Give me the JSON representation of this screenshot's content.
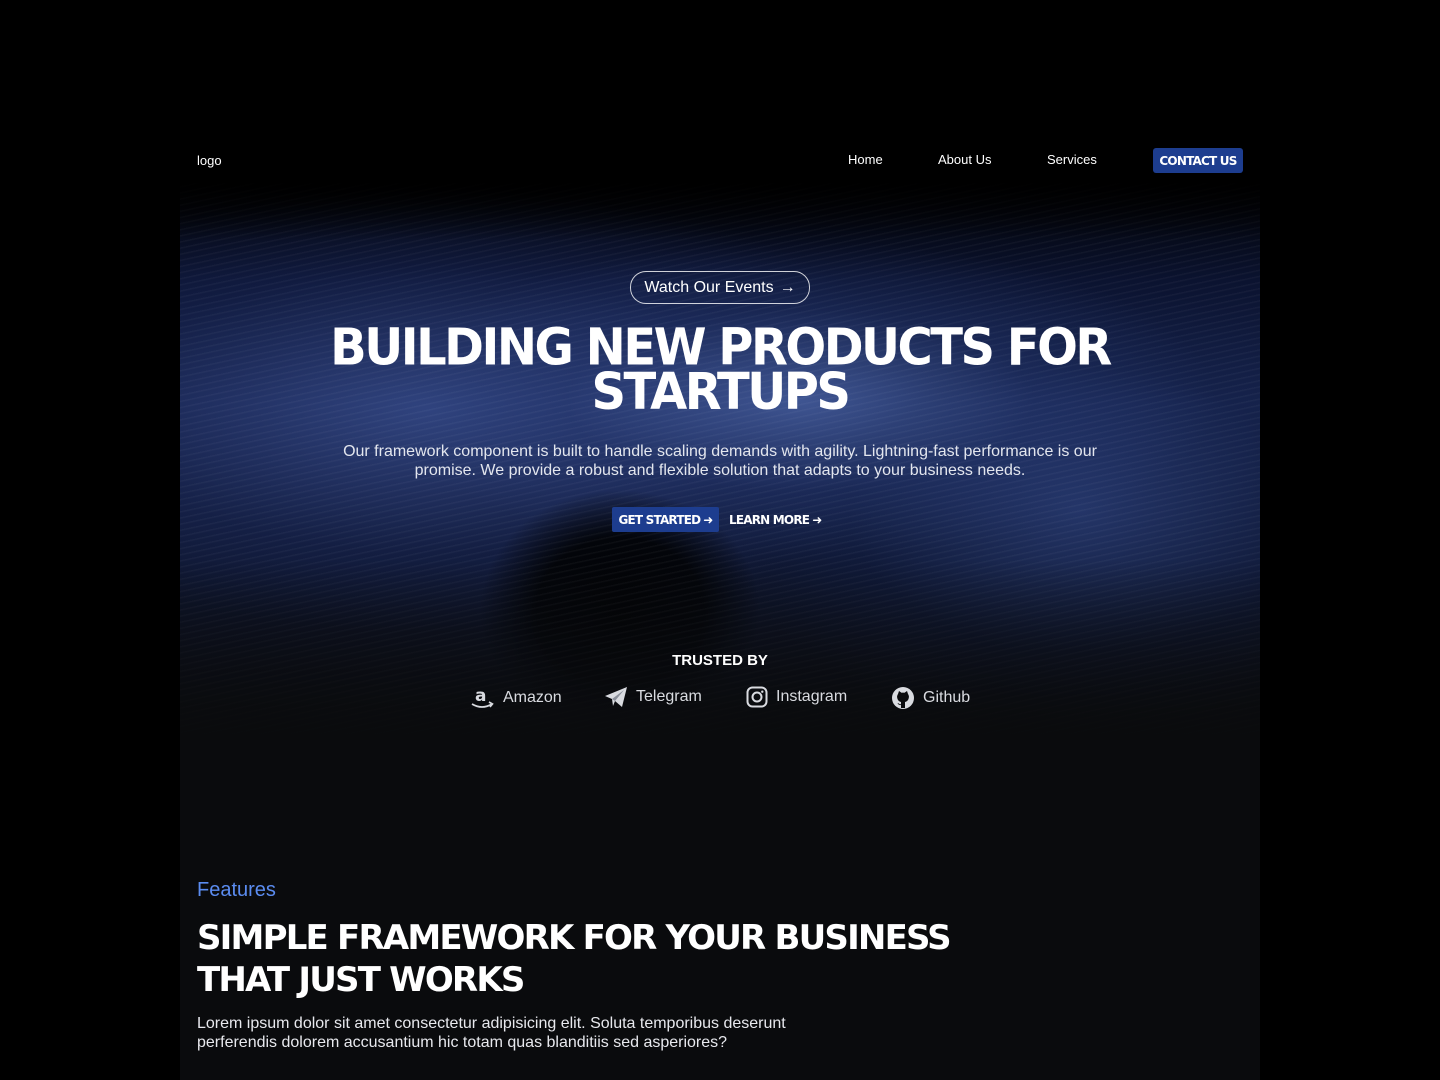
{
  "nav": {
    "logo": "logo",
    "links": [
      "Home",
      "About Us",
      "Services"
    ],
    "contact": "CONTACT US"
  },
  "hero": {
    "events_label": "Watch Our Events",
    "title_line1": "BUILDING NEW PRODUCTS FOR",
    "title_line2": "STARTUPS",
    "description": "Our framework component is built to handle scaling demands with agility. Lightning-fast performance is our promise. We provide a robust and flexible solution that adapts to your business needs.",
    "get_started": "GET STARTED",
    "learn_more": "LEARN MORE"
  },
  "trusted": {
    "heading": "TRUSTED BY",
    "brands": [
      {
        "name": "Amazon",
        "icon": "amazon-icon"
      },
      {
        "name": "Telegram",
        "icon": "telegram-icon"
      },
      {
        "name": "Instagram",
        "icon": "instagram-icon"
      },
      {
        "name": "Github",
        "icon": "github-icon"
      }
    ]
  },
  "features": {
    "label": "Features",
    "title_line1": "SIMPLE FRAMEWORK FOR YOUR BUSINESS",
    "title_line2": "THAT JUST WORKS",
    "description": "Lorem ipsum dolor sit amet consectetur adipisicing elit. Soluta temporibus deserunt perferendis dolorem accusantium hic totam quas blanditiis sed asperiores?"
  },
  "colors": {
    "accent": "#1d3d8f",
    "features_label": "#5b8cf0",
    "background": "#0a0b0d"
  }
}
